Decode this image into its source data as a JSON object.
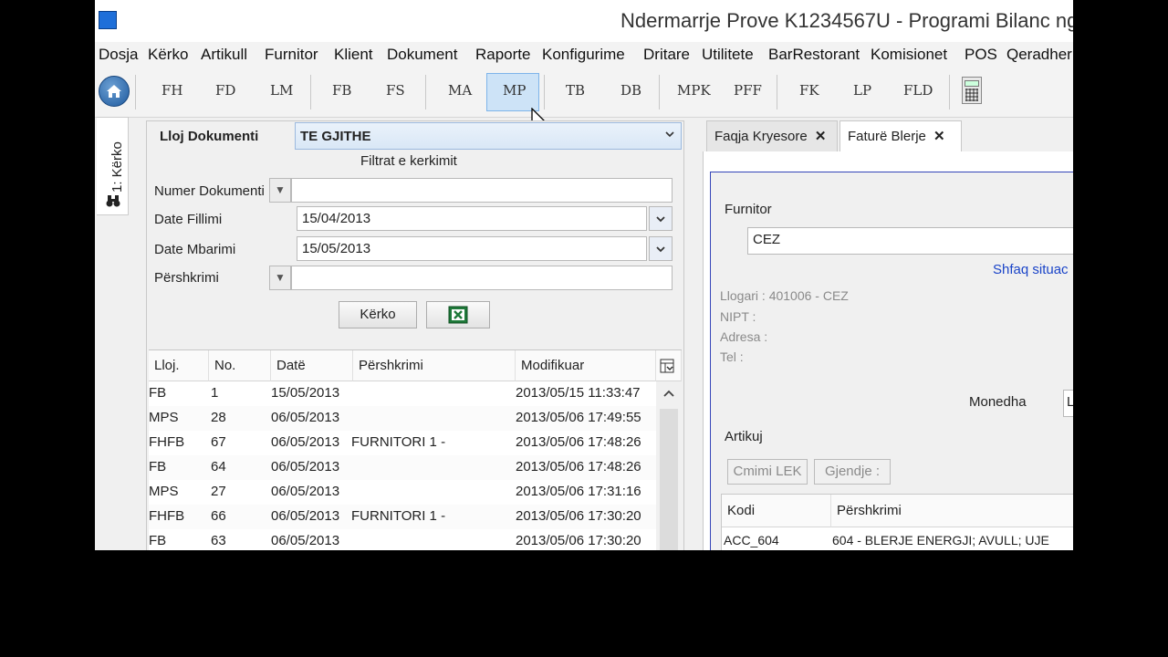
{
  "window": {
    "title": "Ndermarrje Prove K1234567U - Programi Bilanc ng"
  },
  "menu": [
    "Dosja",
    "Kërko",
    "Artikull",
    "Furnitor",
    "Klient",
    "Dokument",
    "Raporte",
    "Konfigurime",
    "Dritare",
    "Utilitete",
    "BarRestorant",
    "Komisionet",
    "POS",
    "Qeradher"
  ],
  "toolbar": {
    "buttons": [
      "FH",
      "FD",
      "LM",
      "FB",
      "FS",
      "MA",
      "MP",
      "TB",
      "DB",
      "MPK",
      "PFF",
      "FK",
      "LP",
      "FLD"
    ],
    "active": "MP"
  },
  "side_tab": {
    "label": "1: Kërko"
  },
  "search": {
    "doc_type_label": "Lloj Dokumenti",
    "doc_type_value": "TE GJITHE",
    "filters_title": "Filtrat e kerkimit",
    "doc_number_label": "Numer Dokumenti",
    "doc_number_value": "",
    "start_date_label": "Date Fillimi",
    "start_date_value": "15/04/2013",
    "end_date_label": "Date Mbarimi",
    "end_date_value": "15/05/2013",
    "description_label": "Përshkrimi",
    "description_value": "",
    "search_button": "Kërko"
  },
  "table": {
    "columns": [
      "Lloj.",
      "No.",
      "Datë",
      "Përshkrimi",
      "Modifikuar"
    ],
    "rows": [
      [
        "FB",
        "1",
        "15/05/2013",
        "",
        "2013/05/15 11:33:47"
      ],
      [
        "MPS",
        "28",
        "06/05/2013",
        "",
        "2013/05/06 17:49:55"
      ],
      [
        "FHFB",
        "67",
        "06/05/2013",
        "FURNITORI 1 -",
        "2013/05/06 17:48:26"
      ],
      [
        "FB",
        "64",
        "06/05/2013",
        "",
        "2013/05/06 17:48:26"
      ],
      [
        "MPS",
        "27",
        "06/05/2013",
        "",
        "2013/05/06 17:31:16"
      ],
      [
        "FHFB",
        "66",
        "06/05/2013",
        "FURNITORI 1 -",
        "2013/05/06 17:30:20"
      ],
      [
        "FB",
        "63",
        "06/05/2013",
        "",
        "2013/05/06 17:30:20"
      ]
    ]
  },
  "right": {
    "tabs": [
      "Faqja Kryesore",
      "Faturë Blerje"
    ],
    "supplier_label": "Furnitor",
    "supplier_value": "CEZ",
    "show_situation_link": "Shfaq situac",
    "account_line": "Llogari  : 401006 - CEZ",
    "nipt_line": "NIPT    :",
    "address_line": "Adresa :",
    "tel_line": "Tel      :",
    "currency_label": "Monedha",
    "currency_value": "L",
    "items_label": "Artikuj",
    "price_button": "Cmimi LEK",
    "stock_button": "Gjendje :",
    "item_columns": [
      "Kodi",
      "Përshkrimi"
    ],
    "item_row": [
      "ACC_604",
      "604 - BLERJE ENERGJI; AVULL; UJE"
    ]
  }
}
